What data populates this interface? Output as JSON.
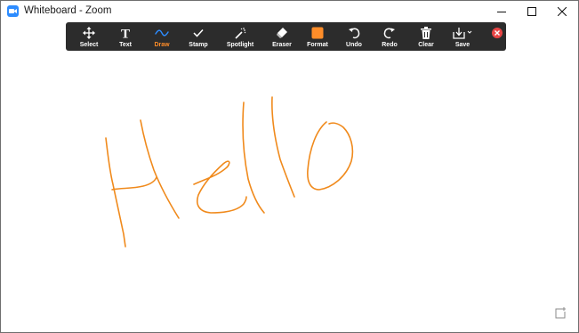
{
  "window": {
    "title": "Whiteboard - Zoom"
  },
  "toolbar": {
    "tools": [
      {
        "label": "Select",
        "icon": "move-icon"
      },
      {
        "label": "Text",
        "icon": "text-icon"
      },
      {
        "label": "Draw",
        "icon": "draw-icon",
        "active": true
      },
      {
        "label": "Stamp",
        "icon": "checkmark-icon"
      },
      {
        "label": "Spotlight",
        "icon": "spotlight-icon"
      },
      {
        "label": "Eraser",
        "icon": "eraser-icon"
      },
      {
        "label": "Format",
        "icon": "format-swatch-icon"
      },
      {
        "label": "Undo",
        "icon": "undo-icon"
      },
      {
        "label": "Redo",
        "icon": "redo-icon"
      },
      {
        "label": "Clear",
        "icon": "trash-icon"
      },
      {
        "label": "Save",
        "icon": "save-icon"
      }
    ]
  },
  "colors": {
    "toolbar_bg": "#2c2c2c",
    "accent": "#ff8d29",
    "ink": "#f08a1c",
    "close": "#e84545",
    "zoom_blue": "#2d8cff"
  }
}
